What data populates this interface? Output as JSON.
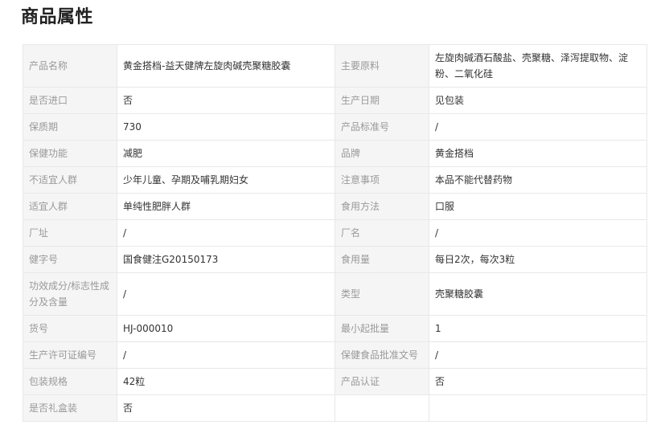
{
  "section": {
    "title": "商品属性"
  },
  "rows": [
    [
      {
        "label": "产品名称",
        "value": "黄金搭档-益天健牌左旋肉碱壳聚糖胶囊"
      },
      {
        "label": "主要原料",
        "value": "左旋肉碱酒石酸盐、壳聚糖、泽泻提取物、淀粉、二氧化硅"
      }
    ],
    [
      {
        "label": "是否进口",
        "value": "否"
      },
      {
        "label": "生产日期",
        "value": "见包装"
      }
    ],
    [
      {
        "label": "保质期",
        "value": "730"
      },
      {
        "label": "产品标准号",
        "value": "/"
      }
    ],
    [
      {
        "label": "保健功能",
        "value": "减肥"
      },
      {
        "label": "品牌",
        "value": "黄金搭档"
      }
    ],
    [
      {
        "label": "不适宜人群",
        "value": "少年儿童、孕期及哺乳期妇女"
      },
      {
        "label": "注意事项",
        "value": "本品不能代替药物"
      }
    ],
    [
      {
        "label": "适宜人群",
        "value": "单纯性肥胖人群"
      },
      {
        "label": "食用方法",
        "value": "口服"
      }
    ],
    [
      {
        "label": "厂址",
        "value": "/"
      },
      {
        "label": "厂名",
        "value": "/"
      }
    ],
    [
      {
        "label": "健字号",
        "value": "国食健注G20150173"
      },
      {
        "label": "食用量",
        "value": "每日2次，每次3粒"
      }
    ],
    [
      {
        "label": "功效成分/标志性成分及含量",
        "value": "/"
      },
      {
        "label": "类型",
        "value": "壳聚糖胶囊"
      }
    ],
    [
      {
        "label": "货号",
        "value": "HJ-000010"
      },
      {
        "label": "最小起批量",
        "value": "1"
      }
    ],
    [
      {
        "label": "生产许可证编号",
        "value": "/"
      },
      {
        "label": "保健食品批准文号",
        "value": "/"
      }
    ],
    [
      {
        "label": "包装规格",
        "value": "42粒"
      },
      {
        "label": "产品认证",
        "value": "否"
      }
    ],
    [
      {
        "label": "是否礼盒装",
        "value": "否"
      },
      {
        "label": "",
        "value": ""
      }
    ]
  ]
}
